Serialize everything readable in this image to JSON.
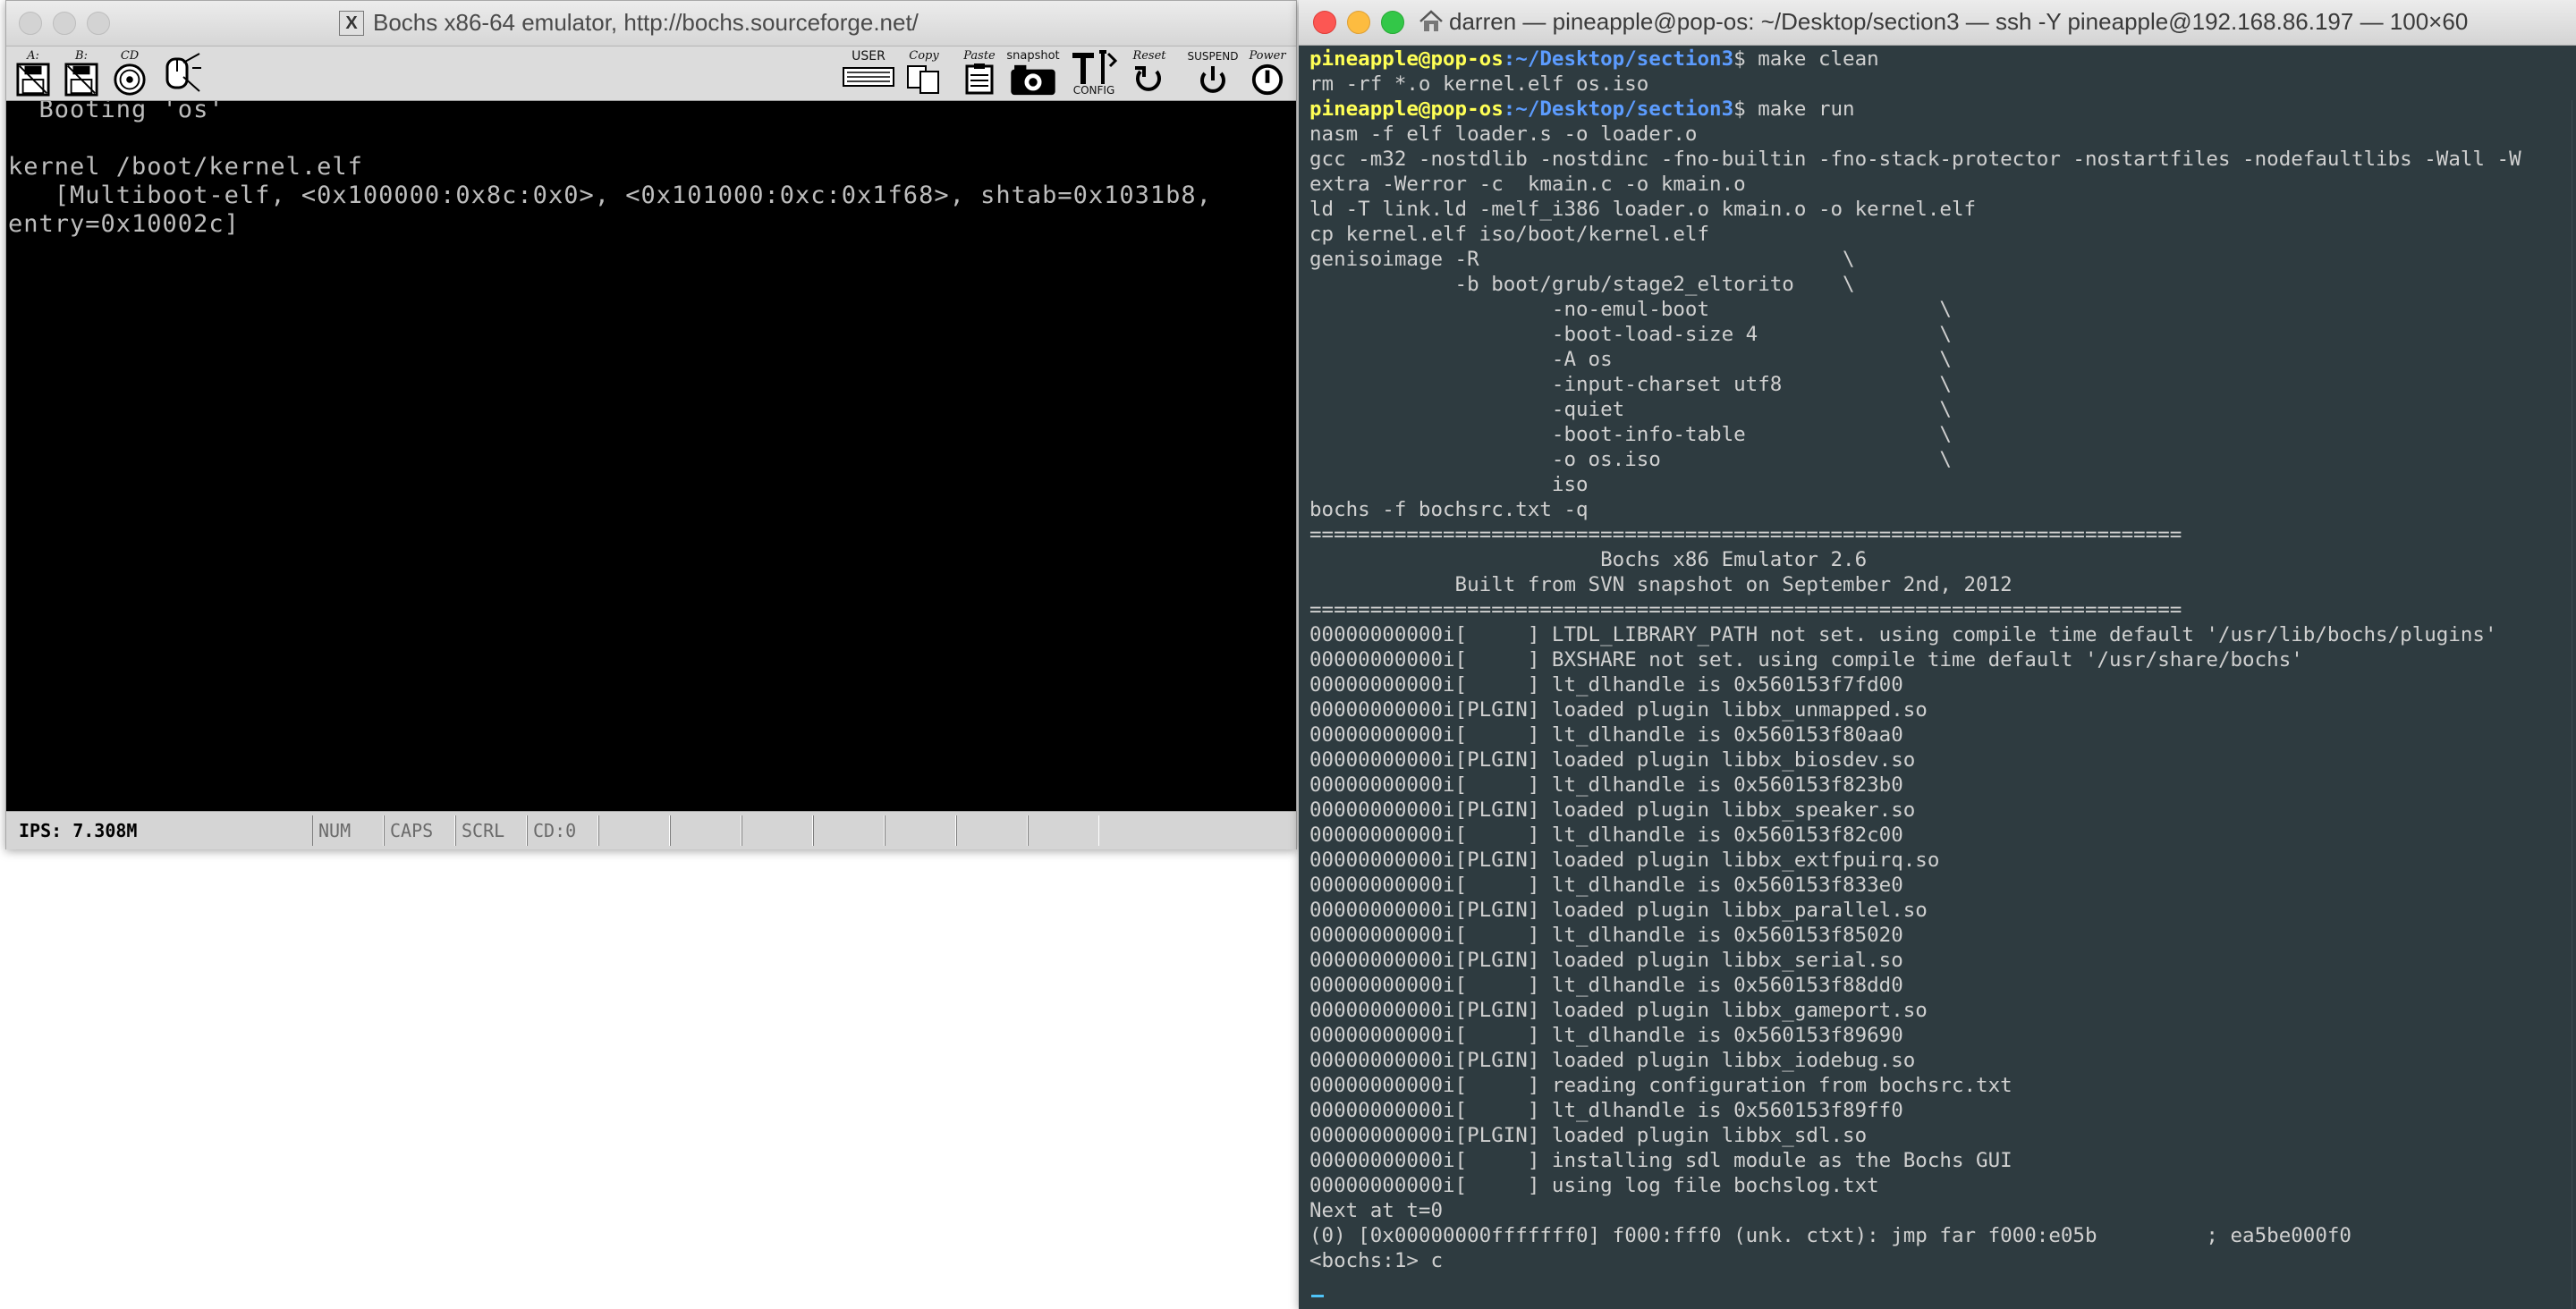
{
  "bochs": {
    "title": "Bochs x86-64 emulator, http://bochs.sourceforge.net/",
    "toolbar": {
      "floppy_a": "A:",
      "floppy_b": "B:",
      "cdrom": "CD",
      "user": "USER",
      "copy": "Copy",
      "paste": "Paste",
      "snapshot": "snapshot",
      "config": "CONFIG",
      "reset": "Reset",
      "suspend": "SUSPEND",
      "power": "Power"
    },
    "screen_lines": [
      "  Booting 'os'",
      "",
      "kernel /boot/kernel.elf",
      "   [Multiboot-elf, <0x100000:0x8c:0x0>, <0x101000:0xc:0x1f68>, shtab=0x1031b8,",
      "entry=0x10002c]"
    ],
    "status": {
      "ips": "IPS: 7.308M",
      "num": "NUM",
      "caps": "CAPS",
      "scrl": "SCRL",
      "cd": "CD:0"
    }
  },
  "terminal": {
    "title": "darren — pineapple@pop-os: ~/Desktop/section3 — ssh -Y pineapple@192.168.86.197 — 100×60",
    "prompt_user": "pineapple@pop-os",
    "prompt_path": ":~/Desktop/section3",
    "cmd1": "$ make clean",
    "cmd2": "$ make run",
    "lines": [
      "rm -rf *.o kernel.elf os.iso",
      "nasm -f elf loader.s -o loader.o",
      "gcc -m32 -nostdlib -nostdinc -fno-builtin -fno-stack-protector -nostartfiles -nodefaultlibs -Wall -W",
      "extra -Werror -c  kmain.c -o kmain.o",
      "ld -T link.ld -melf_i386 loader.o kmain.o -o kernel.elf",
      "cp kernel.elf iso/boot/kernel.elf",
      "genisoimage -R                              \\",
      "            -b boot/grub/stage2_eltorito    \\",
      "                    -no-emul-boot                   \\",
      "                    -boot-load-size 4               \\",
      "                    -A os                           \\",
      "                    -input-charset utf8             \\",
      "                    -quiet                          \\",
      "                    -boot-info-table                \\",
      "                    -o os.iso                       \\",
      "                    iso",
      "bochs -f bochsrc.txt -q",
      "========================================================================",
      "                        Bochs x86 Emulator 2.6",
      "            Built from SVN snapshot on September 2nd, 2012",
      "========================================================================",
      "00000000000i[     ] LTDL_LIBRARY_PATH not set. using compile time default '/usr/lib/bochs/plugins'",
      "00000000000i[     ] BXSHARE not set. using compile time default '/usr/share/bochs'",
      "00000000000i[     ] lt_dlhandle is 0x560153f7fd00",
      "00000000000i[PLGIN] loaded plugin libbx_unmapped.so",
      "00000000000i[     ] lt_dlhandle is 0x560153f80aa0",
      "00000000000i[PLGIN] loaded plugin libbx_biosdev.so",
      "00000000000i[     ] lt_dlhandle is 0x560153f823b0",
      "00000000000i[PLGIN] loaded plugin libbx_speaker.so",
      "00000000000i[     ] lt_dlhandle is 0x560153f82c00",
      "00000000000i[PLGIN] loaded plugin libbx_extfpuirq.so",
      "00000000000i[     ] lt_dlhandle is 0x560153f833e0",
      "00000000000i[PLGIN] loaded plugin libbx_parallel.so",
      "00000000000i[     ] lt_dlhandle is 0x560153f85020",
      "00000000000i[PLGIN] loaded plugin libbx_serial.so",
      "00000000000i[     ] lt_dlhandle is 0x560153f88dd0",
      "00000000000i[PLGIN] loaded plugin libbx_gameport.so",
      "00000000000i[     ] lt_dlhandle is 0x560153f89690",
      "00000000000i[PLGIN] loaded plugin libbx_iodebug.so",
      "00000000000i[     ] reading configuration from bochsrc.txt",
      "00000000000i[     ] lt_dlhandle is 0x560153f89ff0",
      "00000000000i[PLGIN] loaded plugin libbx_sdl.so",
      "00000000000i[     ] installing sdl module as the Bochs GUI",
      "00000000000i[     ] using log file bochslog.txt",
      "Next at t=0",
      "(0) [0x00000000fffffff0] f000:fff0 (unk. ctxt): jmp far f000:e05b         ; ea5be000f0",
      "<bochs:1> c"
    ]
  }
}
